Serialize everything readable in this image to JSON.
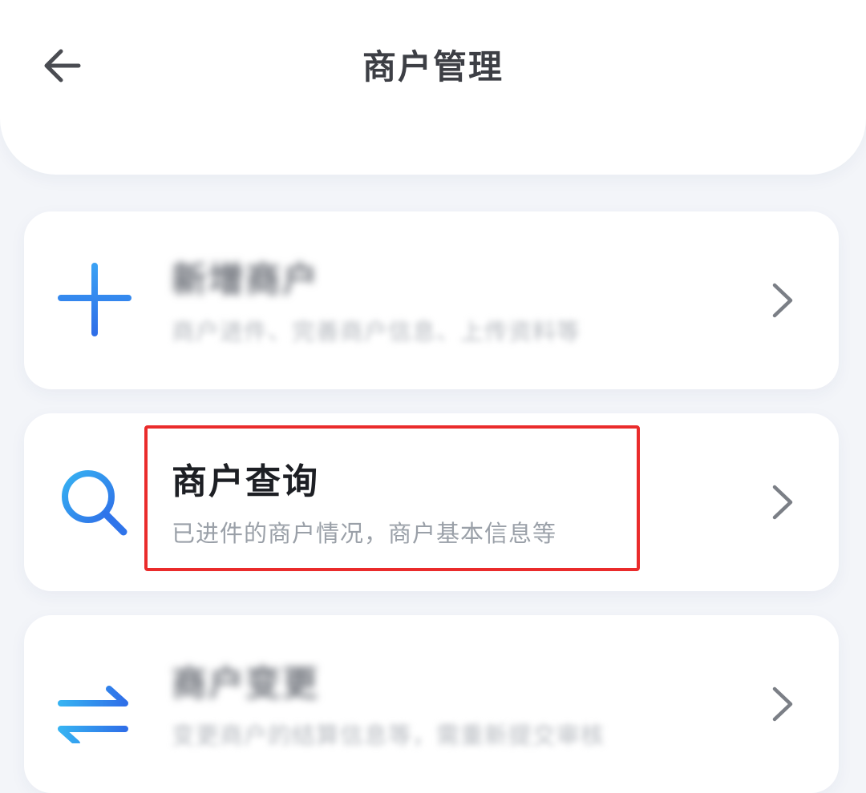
{
  "header": {
    "title": "商户管理",
    "back_icon": "arrow-left-icon"
  },
  "menu": {
    "items": [
      {
        "icon": "plus-icon",
        "title": "新增商户",
        "description": "商户进件、完善商户信息、上传资料等",
        "blurred": true
      },
      {
        "icon": "search-icon",
        "title": "商户查询",
        "description": "已进件的商户情况，商户基本信息等",
        "blurred": false
      },
      {
        "icon": "swap-arrows-icon",
        "title": "商户变更",
        "description": "变更商户的结算信息等，需重新提交审核",
        "blurred": true
      }
    ],
    "chevron_icon": "chevron-right-icon"
  },
  "colors": {
    "accent_blue": "#2f86f1",
    "highlight_red": "#ea2b2b",
    "background": "#f3f5f9"
  }
}
